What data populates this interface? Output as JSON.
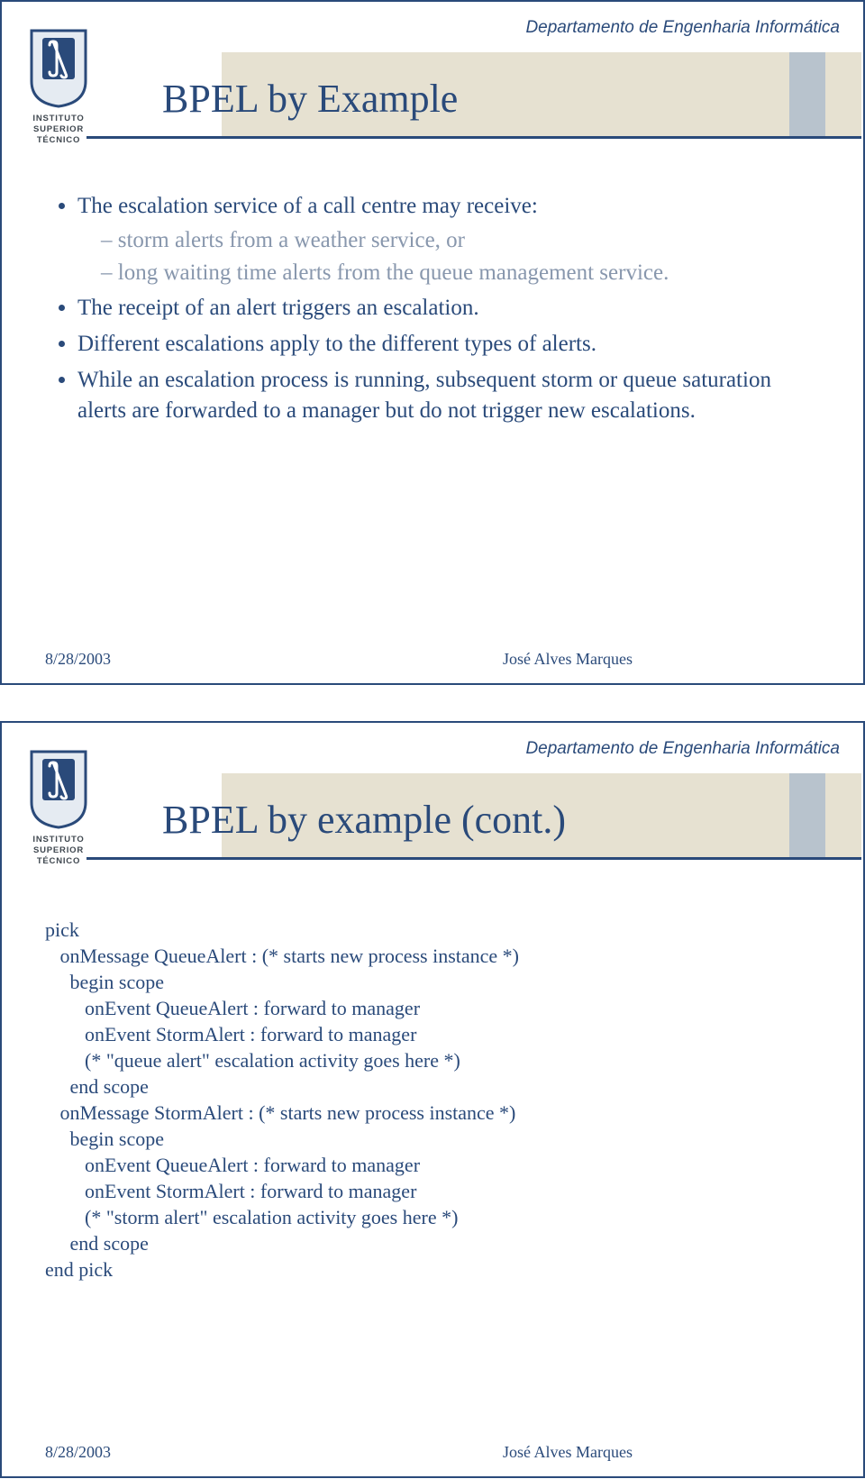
{
  "header": {
    "department": "Departamento de Engenharia Informática"
  },
  "logo": {
    "line1": "INSTITUTO",
    "line2": "SUPERIOR",
    "line3": "TÉCNICO"
  },
  "slide1": {
    "title": "BPEL by Example",
    "bullets": [
      {
        "text": "The escalation service of a call centre may receive:",
        "sub": [
          "storm alerts from a weather service, or",
          "long waiting time alerts from the queue management service."
        ]
      },
      {
        "text": "The receipt of an alert triggers an escalation."
      },
      {
        "text": "Different escalations apply to the different types of alerts."
      },
      {
        "text": "While an escalation process is running, subsequent storm or queue saturation alerts are forwarded to a manager but do not trigger new escalations."
      }
    ]
  },
  "slide2": {
    "title": "BPEL by example (cont.)",
    "code_lines": [
      "pick",
      "   onMessage QueueAlert : (* starts new process instance *)",
      "     begin scope",
      "        onEvent QueueAlert : forward to manager",
      "        onEvent StormAlert : forward to manager",
      "        (* \"queue alert\" escalation activity goes here *)",
      "     end scope",
      "   onMessage StormAlert : (* starts new process instance *)",
      "     begin scope",
      "        onEvent QueueAlert : forward to manager",
      "        onEvent StormAlert : forward to manager",
      "        (* \"storm alert\" escalation activity goes here *)",
      "     end scope",
      "end pick"
    ]
  },
  "footer": {
    "date": "8/28/2003",
    "author": "José Alves Marques"
  }
}
